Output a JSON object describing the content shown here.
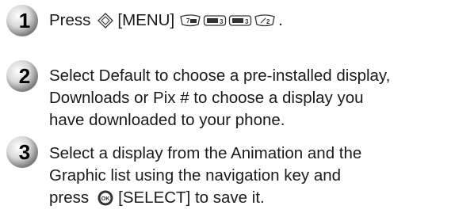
{
  "steps": [
    {
      "number": "1",
      "prefix": "Press",
      "menu_label": "[MENU]",
      "suffix": ".",
      "key_icons": [
        "menu-key-icon",
        "key-7-icon",
        "key-3-icon",
        "key-3-icon",
        "key-2-icon"
      ]
    },
    {
      "number": "2",
      "lines": [
        "Select Default to choose a pre-installed display,",
        "Downloads or Pix # to choose a display you",
        "have downloaded to your phone."
      ]
    },
    {
      "number": "3",
      "lines": [
        "Select a display from the Animation and the",
        "Graphic list using the navigation key and"
      ],
      "last_prefix": "press",
      "last_suffix": "[SELECT] to save it.",
      "key_icons": [
        "ok-key-icon"
      ]
    }
  ],
  "colors": {
    "badge_light": "#f2f2f2",
    "badge_dark": "#8c8c8c",
    "digit": "#000000",
    "key_outline": "#333333"
  }
}
